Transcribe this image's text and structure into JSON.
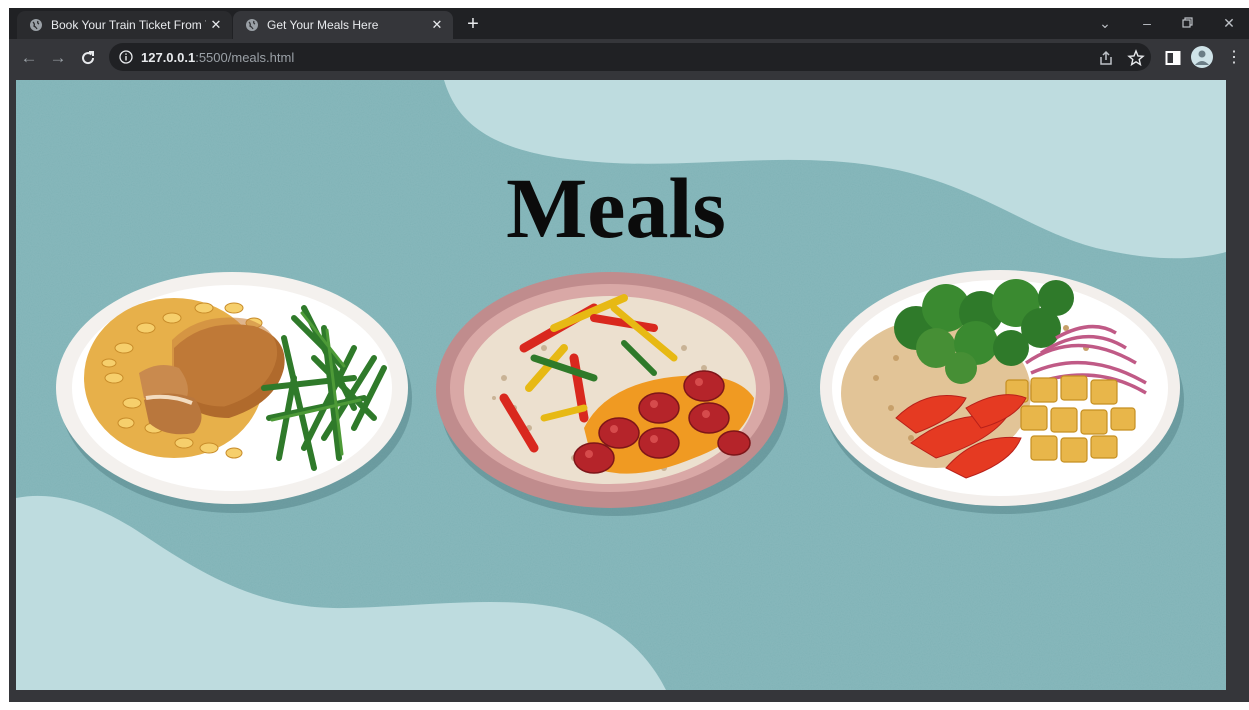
{
  "browser": {
    "tabs": [
      {
        "title": "Book Your Train Ticket From Your",
        "active": false
      },
      {
        "title": "Get Your Meals Here",
        "active": true
      }
    ],
    "address": {
      "host": "127.0.0.1",
      "path": ":5500/meals.html"
    },
    "icons": {
      "back": "arrow-left-icon",
      "forward": "arrow-right-icon",
      "reload": "reload-icon",
      "info": "info-icon",
      "share": "share-icon",
      "bookmark": "star-icon",
      "sidepanel": "side-panel-icon",
      "profile": "profile-avatar",
      "menu": "kebab-menu-icon",
      "newtab": "plus-icon",
      "minimize": "minimize-icon",
      "restore": "restore-icon",
      "close": "close-icon",
      "tabsearch": "chevron-down-icon"
    }
  },
  "page": {
    "heading": "Meals",
    "colors": {
      "background": "#7fb2b6",
      "wave": "#bedcdf",
      "heading": "#0b0b0b"
    },
    "meals": [
      {
        "name": "chicken-mac-greenbeans-plate"
      },
      {
        "name": "rice-peppers-sausage-plate"
      },
      {
        "name": "broccoli-tofu-rice-plate"
      }
    ]
  }
}
